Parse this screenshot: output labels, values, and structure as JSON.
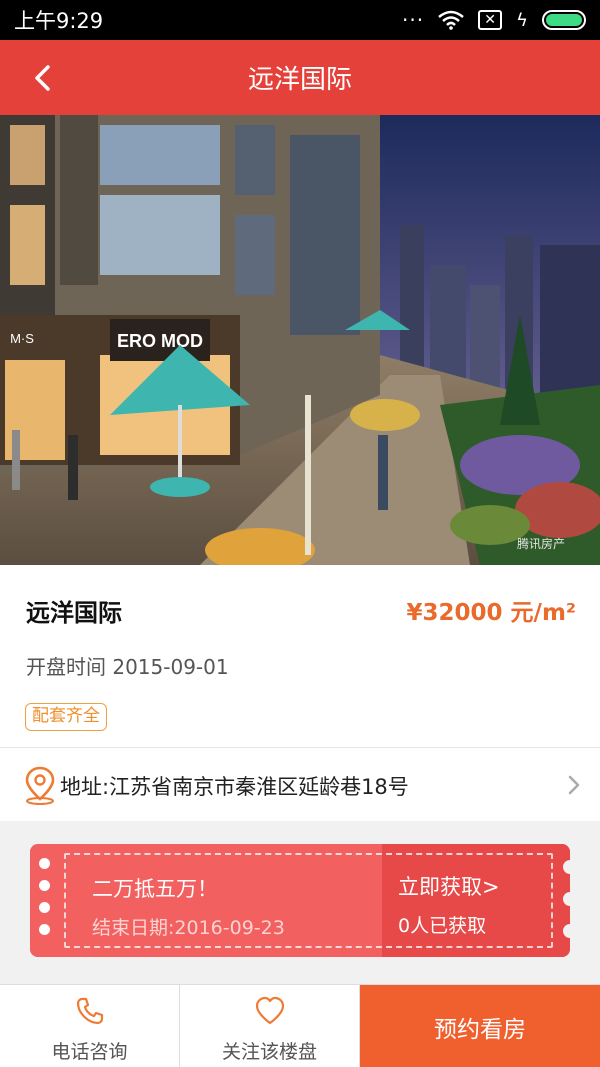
{
  "status_bar": {
    "time": "上午9:29",
    "dots": "···",
    "sim_glyph": "✕",
    "charging_glyph": "ϟ",
    "battery_level": 1.0,
    "icons": [
      "signal-dots-icon",
      "wifi-icon",
      "no-sim-icon",
      "charging-icon",
      "battery-icon"
    ]
  },
  "nav": {
    "title": "远洋国际",
    "back_icon": "chevron-left-icon"
  },
  "hero": {
    "sign_text": "ERO MOD",
    "shop_text": "M·S",
    "watermark": "腾讯房产"
  },
  "property": {
    "name": "远洋国际",
    "price": "¥32000 元/m²",
    "open_date": "开盘时间 2015-09-01",
    "tag": "配套齐全"
  },
  "address": {
    "text": "地址:江苏省南京市秦淮区延龄巷18号",
    "icon": "location-pin-icon",
    "chevron_icon": "chevron-right-icon"
  },
  "coupon": {
    "title": "二万抵五万！",
    "end_date": "结束日期:2016-09-23",
    "action": "立即获取>",
    "count": "0人已获取"
  },
  "bottom_bar": {
    "phone_label": "电话咨询",
    "follow_label": "关注该楼盘",
    "book_label": "预约看房"
  },
  "colors": {
    "primary": "#e5413b",
    "price": "#ea6a2c",
    "tag": "#f0a040",
    "coupon": "#ef5553",
    "book": "#f05f2e"
  }
}
